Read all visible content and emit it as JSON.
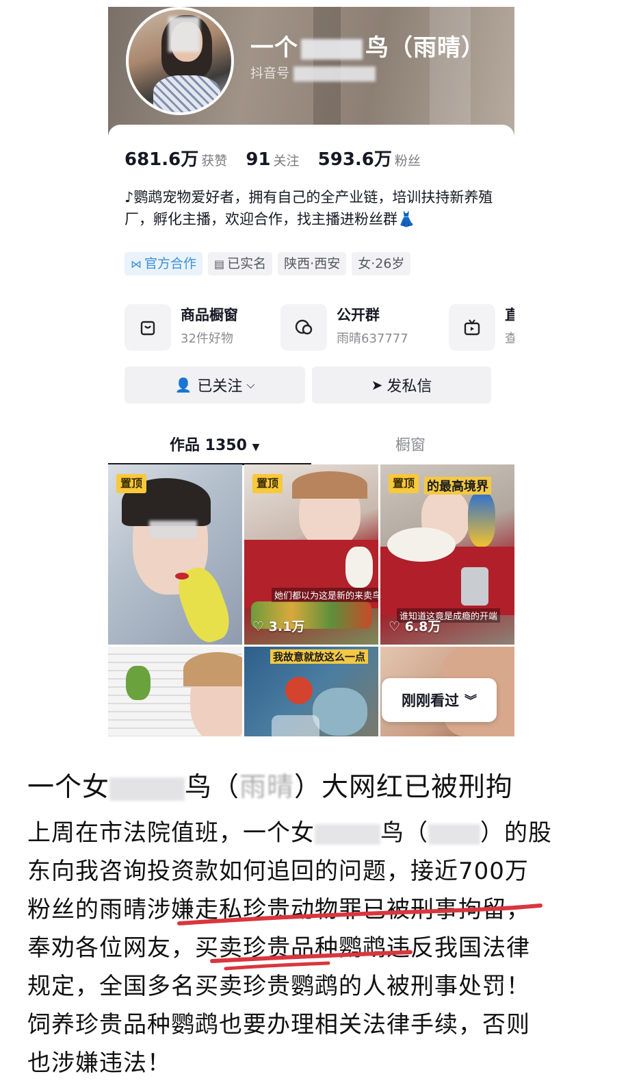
{
  "profile": {
    "nickname_prefix": "一个",
    "nickname_suffix": "鸟（雨晴）",
    "douyin_id_label": "抖音号",
    "stats": [
      {
        "value": "681.6万",
        "label": "获赞"
      },
      {
        "value": "91",
        "label": "关注"
      },
      {
        "value": "593.6万",
        "label": "粉丝"
      }
    ],
    "bio": "♪鹦鹉宠物爱好者，拥有自己的全产业链，培训扶持新养殖厂，孵化主播，欢迎合作，找主播进粉丝群👗",
    "tags": [
      {
        "icon": "official-icon",
        "label": "官方合作"
      },
      {
        "icon": "id-card-icon",
        "label": "已实名"
      },
      {
        "icon": "",
        "label": "陕西·西安"
      },
      {
        "icon": "",
        "label": "女·26岁"
      }
    ],
    "entries": [
      {
        "icon": "shop-bag-icon",
        "title": "商品橱窗",
        "sub": "32件好物"
      },
      {
        "icon": "chat-group-icon",
        "title": "公开群",
        "sub": "雨晴637777"
      },
      {
        "icon": "live-tv-icon",
        "title": "直",
        "sub": "查"
      }
    ],
    "follow_button": "已关注",
    "message_button": "发私信",
    "tabs": {
      "works": "作品 1350",
      "window": "橱窗"
    },
    "videos": [
      {
        "pinned": "置顶",
        "likes": ""
      },
      {
        "pinned": "置顶",
        "likes": "3.1万",
        "caption": "她们都以为这是新的来卖鸟"
      },
      {
        "pinned": "置顶",
        "likes": "6.8万",
        "title": "的最高境界",
        "caption": "谁知道这竟是成瘾的开端"
      },
      {
        "pinned": "",
        "likes": ""
      },
      {
        "pinned": "",
        "likes": "",
        "title": "我故意就放这么一点"
      },
      {
        "pinned": "",
        "likes": ""
      }
    ],
    "recent_chip": "刚刚看过"
  },
  "article": {
    "headline_a": "一个女",
    "headline_b": "鸟（",
    "headline_c": "雨晴",
    "headline_d": "）大网红已被刑拘",
    "paragraph_lines": [
      "上周在市法院值班，一个女",
      "鸟（",
      "）的股",
      "东向我咨询投资款如何追回的问题，接近700万",
      "粉丝的雨晴涉嫌走私珍贵动物罪已被刑事拘留，",
      "奉劝各位网友，买卖珍贵品种鹦鹉违反我国法律",
      "规定，全国多名买卖珍贵鹦鹉的人被刑事处罚！",
      "饲养珍贵品种鹦鹉也要办理相关法律手续，否则",
      "也涉嫌违法！"
    ]
  },
  "colors": {
    "underline": "#d9363e",
    "pin": "#f7c93b",
    "official": "#3c8fd8"
  }
}
